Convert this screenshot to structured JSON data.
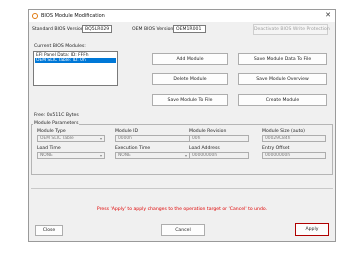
{
  "window": {
    "title": "BIOS Module Modification",
    "close_glyph": "✕"
  },
  "header": {
    "standard_bios_label": "Standard BIOS Version:",
    "standard_bios_value": "BQ5LR029",
    "oem_bios_label": "OEM BIOS Version:",
    "oem_bios_value": "OEM1R001",
    "deactivate_label": "Deactivate BIOS Write Protection"
  },
  "modules": {
    "title": "Current BIOS Modules:",
    "items": [
      "EFI Panel Data: ID: FFFh",
      "OEM SLIC Table: ID: 0h"
    ],
    "selected_index": 1,
    "free_label": "Free: 0x511C Bytes"
  },
  "actions": {
    "add": "Add Module",
    "save_to_file": "Save Module Data To File",
    "delete": "Delete Module",
    "save_overview": "Save Module Overview",
    "save_to_file_2": "Save Module To File",
    "create": "Create Module"
  },
  "params": {
    "title": "Module Parameters",
    "module_type_label": "Module Type",
    "module_type_value": "OEM SLIC Table",
    "module_id_label": "Module ID",
    "module_id_value": "0000h",
    "module_revision_label": "Module Revision",
    "module_revision_value": "00h",
    "module_size_label": "Module Size (auto)",
    "module_size_value": "00029C84h",
    "load_time_label": "Load Time",
    "load_time_value": "NONE",
    "execution_time_label": "Execution Time",
    "execution_time_value": "NONE",
    "load_address_label": "Load Address",
    "load_address_value": "00000000h",
    "entry_offset_label": "Entry Offset",
    "entry_offset_value": "00000000h"
  },
  "footer": {
    "status": "Press 'Apply' to apply changes to the operation target or 'Cancel' to undo.",
    "close": "Close",
    "cancel": "Cancel",
    "apply": "Apply"
  },
  "colors": {
    "accent": "#0078d7",
    "status": "#e00000",
    "apply_border": "#b00000",
    "title_icon": "#e07a10"
  }
}
